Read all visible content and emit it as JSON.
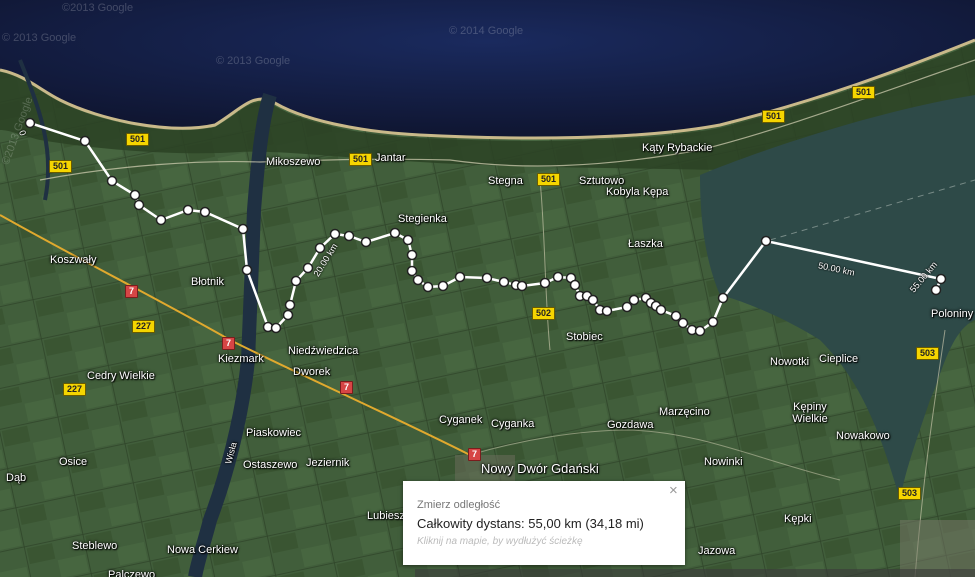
{
  "map": {
    "type": "satellite",
    "copyright": [
      "©2013 Google",
      "© 2013 Google",
      "© 2014 Google",
      "© 2013 Google",
      "©2013 Google"
    ],
    "places": [
      {
        "name": "Mikoszewo"
      },
      {
        "name": "Jantar"
      },
      {
        "name": "Kąty Rybackie"
      },
      {
        "name": "Stegna"
      },
      {
        "name": "Sztutowo"
      },
      {
        "name": "Kobyla Kępa"
      },
      {
        "name": "Stegienka"
      },
      {
        "name": "Łaszka"
      },
      {
        "name": "Koszwały"
      },
      {
        "name": "Błotnik"
      },
      {
        "name": "Kiezmark"
      },
      {
        "name": "Niedźwiedzica"
      },
      {
        "name": "Dworek"
      },
      {
        "name": "Cedry Wielkie"
      },
      {
        "name": "Stobiec"
      },
      {
        "name": "Nowotki"
      },
      {
        "name": "Cieplice"
      },
      {
        "name": "Poloniny"
      },
      {
        "name": "Kępiny Wielkie"
      },
      {
        "name": "Nowakowo"
      },
      {
        "name": "Marzęcino"
      },
      {
        "name": "Gozdawa"
      },
      {
        "name": "Cyganek"
      },
      {
        "name": "Cyganka"
      },
      {
        "name": "Piaskowiec"
      },
      {
        "name": "Ostaszewo"
      },
      {
        "name": "Jeziernik"
      },
      {
        "name": "Nowy Dwór Gdański"
      },
      {
        "name": "Nowinki"
      },
      {
        "name": "Osice"
      },
      {
        "name": "Wisła"
      },
      {
        "name": "Dąb"
      },
      {
        "name": "Lubiesz"
      },
      {
        "name": "Steblewo"
      },
      {
        "name": "Nowa Cerkiew"
      },
      {
        "name": "Kępki"
      },
      {
        "name": "Jazowa"
      },
      {
        "name": "Palczewo"
      }
    ],
    "road_shields": [
      {
        "label": "501",
        "color": "#f5d500"
      },
      {
        "label": "501",
        "color": "#f5d500"
      },
      {
        "label": "501",
        "color": "#f5d500"
      },
      {
        "label": "501",
        "color": "#f5d500"
      },
      {
        "label": "501",
        "color": "#f5d500"
      },
      {
        "label": "501",
        "color": "#f5d500"
      },
      {
        "label": "502",
        "color": "#f5d500"
      },
      {
        "label": "503",
        "color": "#f5d500"
      },
      {
        "label": "503",
        "color": "#f5d500"
      },
      {
        "label": "227",
        "color": "#f5d500"
      },
      {
        "label": "227",
        "color": "#f5d500"
      },
      {
        "label": "7",
        "color": "#d64545"
      },
      {
        "label": "7",
        "color": "#d64545"
      },
      {
        "label": "7",
        "color": "#d64545"
      },
      {
        "label": "7",
        "color": "#d64545"
      }
    ],
    "distance_markers": [
      "0",
      "20.00 km",
      "50.00 km",
      "55.00 km"
    ]
  },
  "measure": {
    "title": "Zmierz odległość",
    "total": "Całkowity dystans: 55,00 km (34,18 mi)",
    "hint": "Kliknij na mapie, by wydłużyć ścieżkę",
    "close_icon": "×"
  },
  "colors": {
    "sea": "#141d3c",
    "land": "#3e5a38",
    "lagoon": "#2e4a48",
    "route": "#ffffff"
  }
}
